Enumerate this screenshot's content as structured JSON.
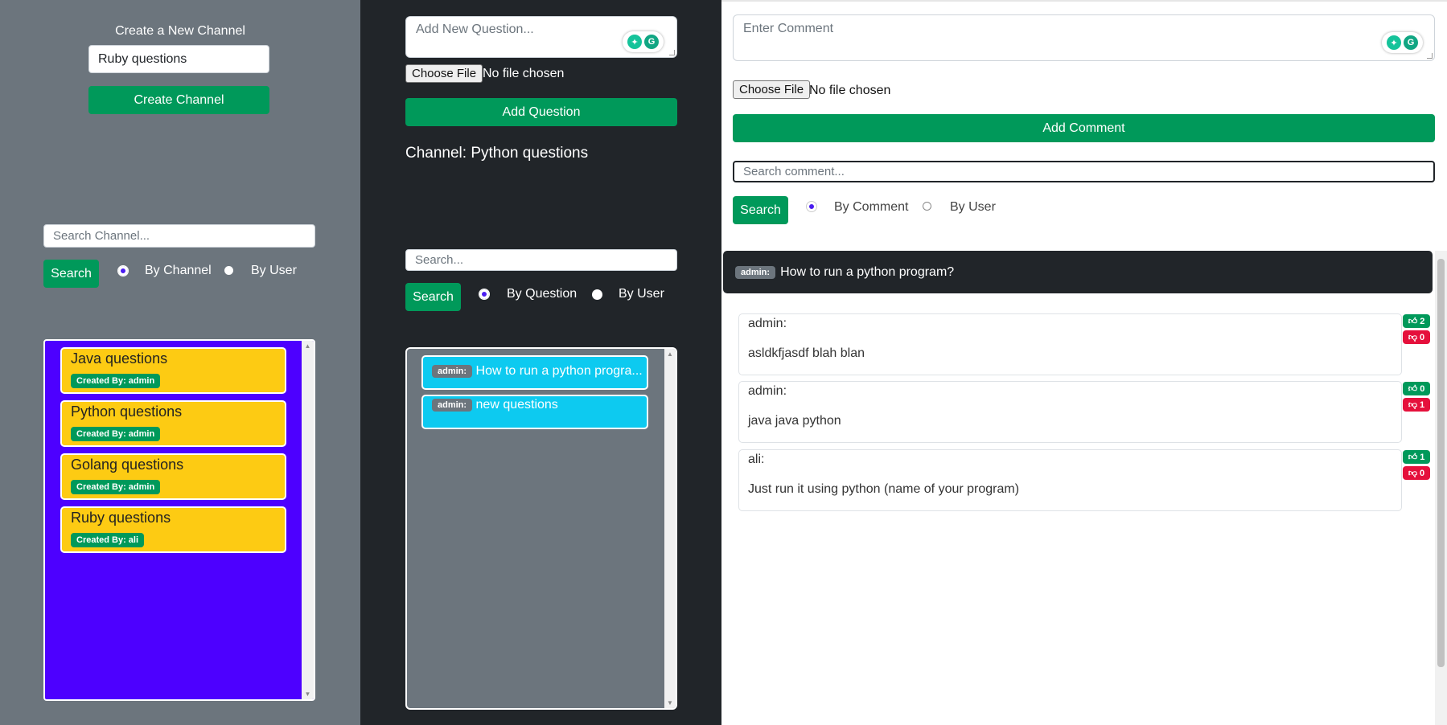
{
  "channels_panel": {
    "create_heading": "Create a New Channel",
    "new_channel_value": "Ruby questions",
    "create_button": "Create Channel",
    "search_placeholder": "Search Channel...",
    "search_button": "Search",
    "radio_by_channel": "By Channel",
    "radio_by_user": "By User",
    "channels": [
      {
        "title": "Java questions",
        "creator": "Created By: admin"
      },
      {
        "title": "Python questions",
        "creator": "Created By: admin"
      },
      {
        "title": "Golang questions",
        "creator": "Created By: admin"
      },
      {
        "title": "Ruby questions",
        "creator": "Created By: ali"
      }
    ]
  },
  "questions_panel": {
    "question_placeholder": "Add New Question...",
    "choose_file": "Choose File",
    "no_file": "No file chosen",
    "add_button": "Add Question",
    "channel_title": "Channel: Python questions",
    "search_placeholder": "Search...",
    "search_button": "Search",
    "radio_by_question": "By Question",
    "radio_by_user": "By User",
    "questions": [
      {
        "user": "admin:",
        "text": "How to run a python progra..."
      },
      {
        "user": "admin:",
        "text": "new questions"
      }
    ]
  },
  "comments_panel": {
    "comment_placeholder": "Enter Comment",
    "choose_file": "Choose File",
    "no_file": "No file chosen",
    "add_button": "Add Comment",
    "search_placeholder": "Search comment...",
    "search_button": "Search",
    "radio_by_comment": "By Comment",
    "radio_by_user": "By User",
    "thread": {
      "user": "admin:",
      "title": "How to run a python program?"
    },
    "comments": [
      {
        "user": "admin:",
        "text": "asldkfjasdf blah blan",
        "likes": "2",
        "dislikes": "0"
      },
      {
        "user": "admin:",
        "text": "java java python",
        "likes": "0",
        "dislikes": "1"
      },
      {
        "user": "ali:",
        "text": "Just run it using python (name of your program)",
        "likes": "1",
        "dislikes": "0"
      }
    ]
  },
  "colors": {
    "accent_green": "#00995a",
    "channel_list_bg": "#4d00ff",
    "channel_card": "#fdcb13",
    "question_card": "#0dcaf0",
    "dislike_red": "#e5103c"
  }
}
